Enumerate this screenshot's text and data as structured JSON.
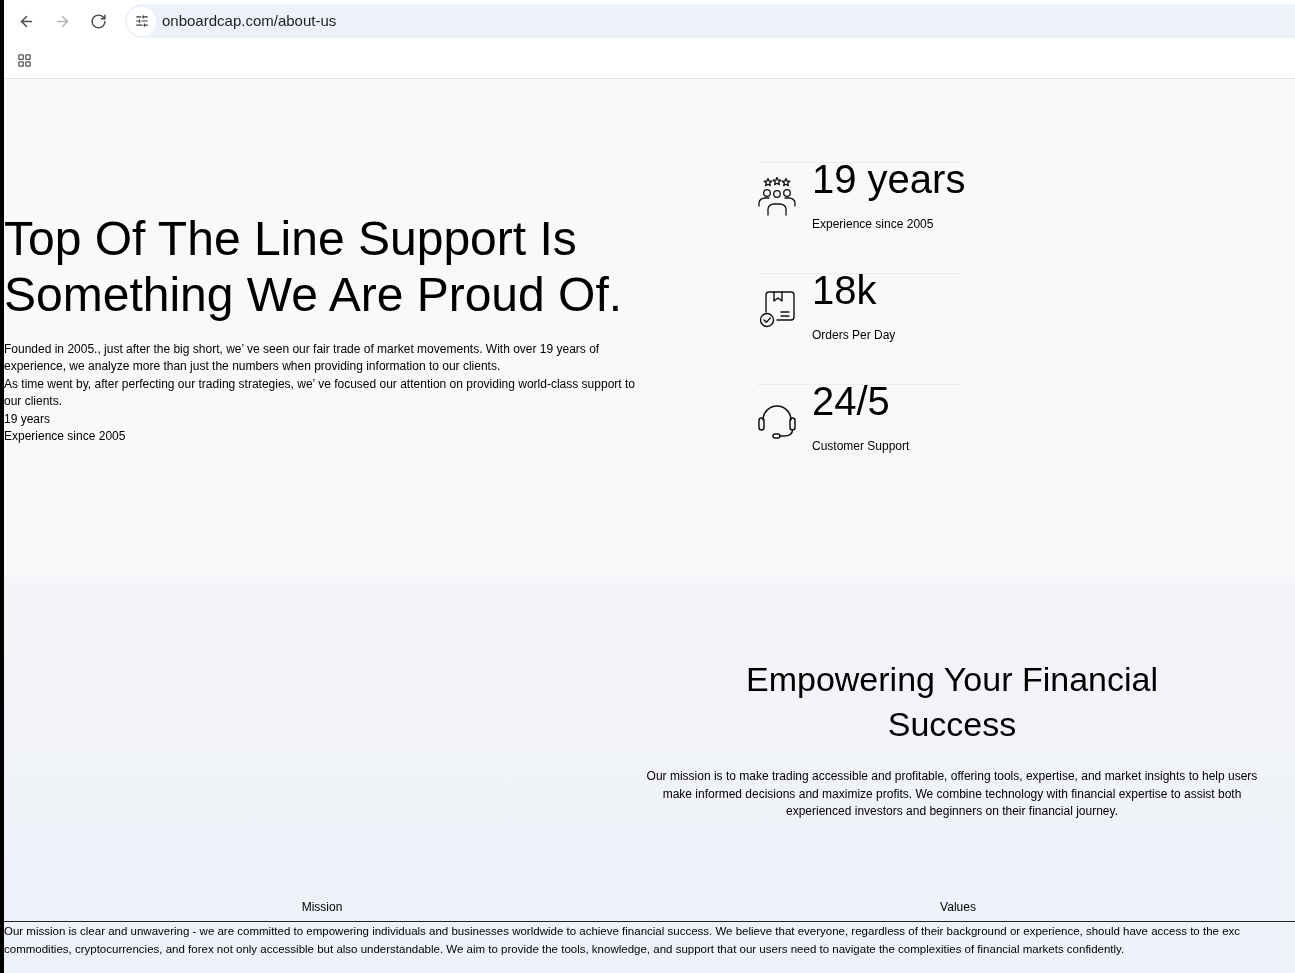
{
  "browser": {
    "nav_buttons": [
      {
        "kind": "back",
        "disabled": false
      },
      {
        "kind": "forward",
        "disabled": true
      },
      {
        "kind": "reload",
        "disabled": false
      }
    ],
    "url": "onboardcap.com/about-us"
  },
  "about": {
    "heading": "Top Of The Line Support Is Something We Are Proud Of.",
    "paragraphs": [
      "Founded in 2005., just after the big short, we’ ve seen our fair trade of market movements. With over 19 years of experience, we analyze more than just the numbers when providing information to our clients.",
      "As time went by, after perfecting our trading strategies, we’ ve focused our attention on providing world-class support to our clients."
    ],
    "stat": {
      "value": "19 years",
      "label": "Experience since 2005"
    }
  },
  "stats": [
    {
      "value": "19 years",
      "label": "Experience since 2005"
    },
    {
      "value": "18k",
      "label": "Orders Per Day"
    },
    {
      "value": "24/5",
      "label": "Customer Support"
    }
  ],
  "mission": {
    "heading": "Empowering Your Financial Success",
    "text": "Our mission is to make trading accessible and profitable, offering tools, expertise, and market insights to help users make informed decisions and maximize profits. We combine technology with financial expertise to assist both experienced investors and beginners on their financial journey."
  },
  "tabs": [
    "Mission",
    "Values"
  ],
  "tab_panel": {
    "lines": [
      "Our mission is clear and unwavering - we are committed to empowering individuals and businesses worldwide to achieve financial success. We believe that everyone, regardless of their background or experience, should have access to the exc",
      "commodities, cryptocurrencies, and forex not only accessible but also understandable. We aim to provide the tools, knowledge, and support that our users need to navigate the complexities of financial markets confidently."
    ]
  }
}
